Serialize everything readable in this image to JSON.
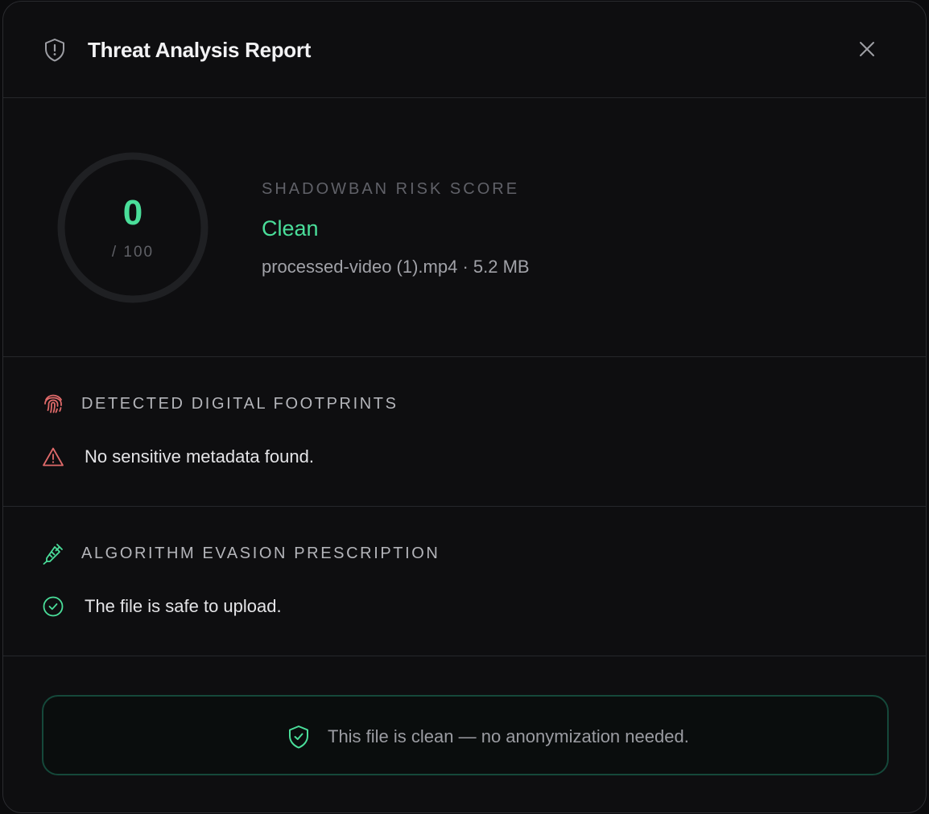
{
  "header": {
    "title": "Threat Analysis Report",
    "icon": "shield-alert-icon",
    "close_icon": "close-icon"
  },
  "score": {
    "value": "0",
    "max_label": "/ 100",
    "fraction": 0,
    "label": "SHADOWBAN RISK SCORE",
    "status": "Clean",
    "file_info": "processed-video (1).mp4 · 5.2 MB"
  },
  "footprints": {
    "icon": "fingerprint-icon",
    "title": "DETECTED DIGITAL FOOTPRINTS",
    "row_icon": "warning-triangle-icon",
    "message": "No sensitive metadata found."
  },
  "prescription": {
    "icon": "syringe-icon",
    "title": "ALGORITHM EVASION PRESCRIPTION",
    "row_icon": "check-circle-icon",
    "message": "The file is safe to upload."
  },
  "banner": {
    "icon": "shield-check-icon",
    "text": "This file is clean — no anonymization needed."
  },
  "colors": {
    "accent_green": "#4ade9a",
    "warning_red": "#e06a6a",
    "background": "#0e0e10"
  }
}
